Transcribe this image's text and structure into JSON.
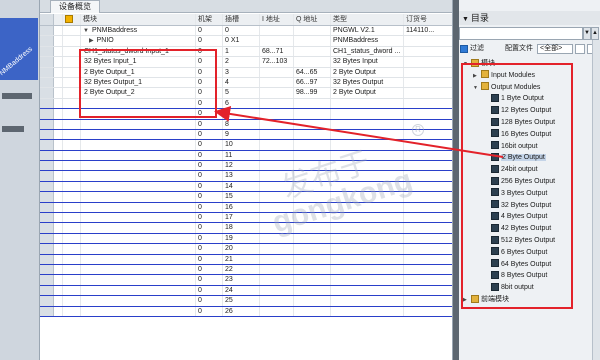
{
  "left_strip": {
    "label": "NMBaddress"
  },
  "panel": {
    "tab_label": "设备概览"
  },
  "grid": {
    "columns": {
      "module": "模块",
      "rack": "机架",
      "slot": "插槽",
      "iaddr": "I 地址",
      "qaddr": "Q 地址",
      "type": "类型",
      "order": "订货号"
    },
    "rows": [
      {
        "arrow": "▼",
        "module": "PNMBaddress",
        "rack": "0",
        "slot": "0",
        "iaddr": "",
        "qaddr": "",
        "type": "PNGWL V2.1",
        "order": "114110..."
      },
      {
        "arrow": "▶",
        "module": "PNIO",
        "rack": "0",
        "slot": "0 X1",
        "iaddr": "",
        "qaddr": "",
        "type": "PNMBaddress",
        "order": ""
      },
      {
        "arrow": "",
        "module": "CH1_status_dword Input_1",
        "rack": "0",
        "slot": "1",
        "iaddr": "68...71",
        "qaddr": "",
        "type": "CH1_status_dword ...",
        "order": ""
      },
      {
        "arrow": "",
        "module": "32 Bytes Input_1",
        "rack": "0",
        "slot": "2",
        "iaddr": "72...103",
        "qaddr": "",
        "type": "32 Bytes Input",
        "order": ""
      },
      {
        "arrow": "",
        "module": "2 Byte Output_1",
        "rack": "0",
        "slot": "3",
        "iaddr": "",
        "qaddr": "64...65",
        "type": "2 Byte Output",
        "order": ""
      },
      {
        "arrow": "",
        "module": "32 Bytes Output_1",
        "rack": "0",
        "slot": "4",
        "iaddr": "",
        "qaddr": "66...97",
        "type": "32 Bytes Output",
        "order": ""
      },
      {
        "arrow": "",
        "module": "2 Byte Output_2",
        "rack": "0",
        "slot": "5",
        "iaddr": "",
        "qaddr": "98...99",
        "type": "2 Byte Output",
        "order": ""
      }
    ],
    "empty_slots": [
      "6",
      "7",
      "8",
      "9",
      "10",
      "11",
      "12",
      "13",
      "14",
      "15",
      "16",
      "17",
      "18",
      "19",
      "20",
      "21",
      "22",
      "23",
      "24",
      "25",
      "26"
    ],
    "empty_rack": "0"
  },
  "watermark": {
    "cn": "发布于",
    "en": "gongkong",
    "reg": "R"
  },
  "catalog": {
    "title": "目录",
    "search_value": "",
    "filter_label": "过滤",
    "profile_label": "配置文件",
    "profile_value": "<全部>",
    "tree": [
      {
        "label": "模块",
        "depth": 0,
        "arrow": "▼",
        "icon": "folder"
      },
      {
        "label": "Input Modules",
        "depth": 1,
        "arrow": "▶",
        "icon": "folder"
      },
      {
        "label": "Output Modules",
        "depth": 1,
        "arrow": "▼",
        "icon": "folder"
      },
      {
        "label": "1 Byte Output",
        "depth": 2,
        "arrow": "",
        "icon": "module"
      },
      {
        "label": "12 Bytes Output",
        "depth": 2,
        "arrow": "",
        "icon": "module"
      },
      {
        "label": "128 Bytes Output",
        "depth": 2,
        "arrow": "",
        "icon": "module"
      },
      {
        "label": "16 Bytes Output",
        "depth": 2,
        "arrow": "",
        "icon": "module"
      },
      {
        "label": "16bit output",
        "depth": 2,
        "arrow": "",
        "icon": "module"
      },
      {
        "label": "2 Byte Output",
        "depth": 2,
        "arrow": "",
        "icon": "module",
        "selected": true
      },
      {
        "label": "24bit output",
        "depth": 2,
        "arrow": "",
        "icon": "module"
      },
      {
        "label": "256 Bytes Output",
        "depth": 2,
        "arrow": "",
        "icon": "module"
      },
      {
        "label": "3 Bytes Output",
        "depth": 2,
        "arrow": "",
        "icon": "module"
      },
      {
        "label": "32 Bytes Output",
        "depth": 2,
        "arrow": "",
        "icon": "module"
      },
      {
        "label": "4 Bytes Output",
        "depth": 2,
        "arrow": "",
        "icon": "module"
      },
      {
        "label": "42 Bytes Output",
        "depth": 2,
        "arrow": "",
        "icon": "module"
      },
      {
        "label": "512 Bytes Output",
        "depth": 2,
        "arrow": "",
        "icon": "module"
      },
      {
        "label": "6 Bytes Output",
        "depth": 2,
        "arrow": "",
        "icon": "module"
      },
      {
        "label": "64 Bytes Output",
        "depth": 2,
        "arrow": "",
        "icon": "module"
      },
      {
        "label": "8 Bytes Output",
        "depth": 2,
        "arrow": "",
        "icon": "module"
      },
      {
        "label": "8bit output",
        "depth": 2,
        "arrow": "",
        "icon": "module"
      },
      {
        "label": "前端模块",
        "depth": 0,
        "arrow": "▶",
        "icon": "folder"
      }
    ]
  },
  "colors": {
    "highlight": "#e3222a",
    "empty_row_line": "#2a3fc9",
    "selection": "#c4d4e8"
  }
}
